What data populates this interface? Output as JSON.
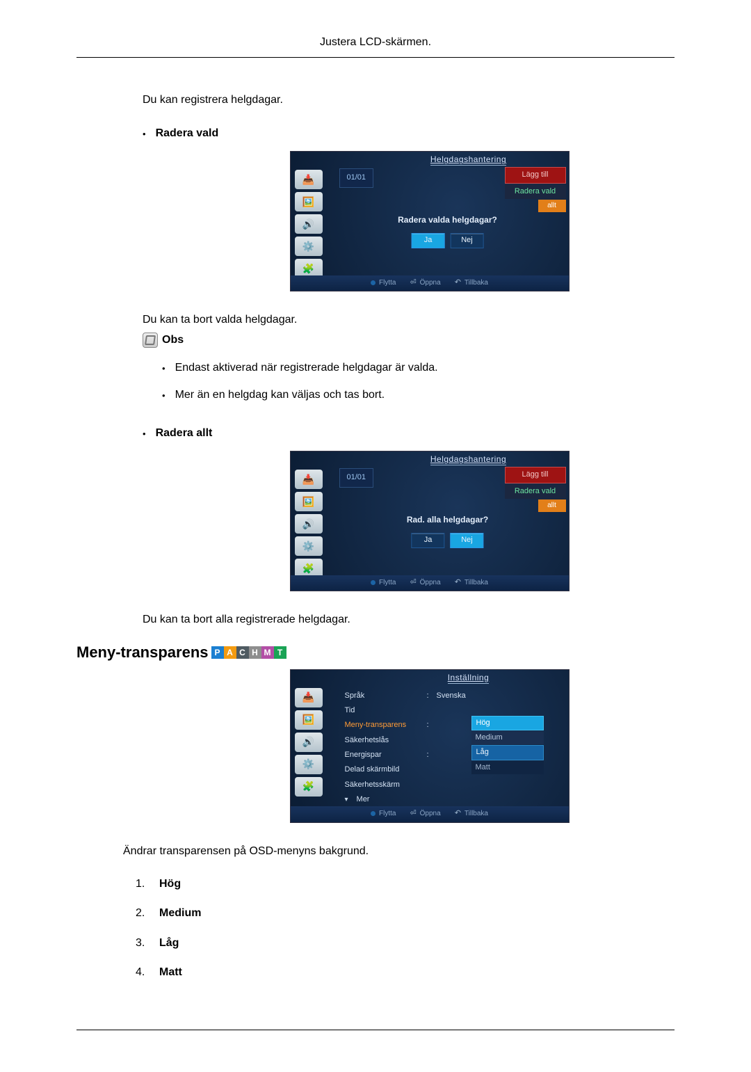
{
  "page_title": "Justera LCD-skärmen.",
  "intro_register": "Du kan registrera helgdagar.",
  "sections": {
    "radera_vald": {
      "label": "Radera vald",
      "after_text": "Du kan ta bort valda helgdagar.",
      "note_label": "Obs",
      "notes": [
        "Endast aktiverad när registrerade helgdagar är valda.",
        "Mer än en helgdag kan väljas och tas bort."
      ]
    },
    "radera_allt": {
      "label": "Radera allt",
      "after_text": "Du kan ta bort alla registrerade helgdagar."
    },
    "meny_transparens": {
      "heading": "Meny-transparens",
      "modes": [
        "P",
        "A",
        "C",
        "H",
        "M",
        "T"
      ],
      "intro": "Ändrar transparensen på OSD-menyns bakgrund.",
      "options": [
        "Hög",
        "Medium",
        "Låg",
        "Matt"
      ]
    }
  },
  "osd": {
    "title_holiday": "Helgdagshantering",
    "title_settings": "Inställning",
    "date": "01/01",
    "action_add": "Lägg till",
    "action_delete": "Radera vald",
    "action_allt_highlight": "allt",
    "dialog_delete_selected": "Radera valda helgdagar?",
    "dialog_delete_all": "Rad. alla helgdagar?",
    "btn_yes": "Ja",
    "btn_no": "Nej",
    "footer_move": "Flytta",
    "footer_open": "Öppna",
    "footer_back": "Tillbaka",
    "settings_rows": {
      "sprak_key": "Språk",
      "sprak_val": "Svenska",
      "tid_key": "Tid",
      "meny_key": "Meny-transparens",
      "sakerhetslas_key": "Säkerhetslås",
      "energispar_key": "Energispar",
      "delad_key": "Delad skärmbild",
      "sakerhetsskarm_key": "Säkerhetsskärm",
      "mer_key": "Mer"
    },
    "opt_hog": "Hög",
    "opt_medium": "Medium",
    "opt_lag": "Låg",
    "opt_matt": "Matt"
  }
}
